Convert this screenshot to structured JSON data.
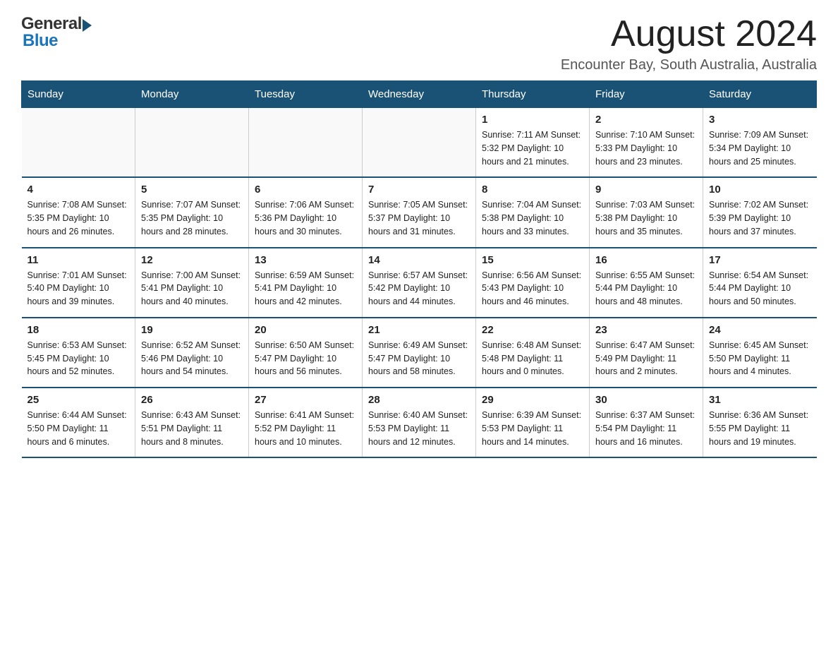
{
  "header": {
    "logo_general": "General",
    "logo_blue": "Blue",
    "month_title": "August 2024",
    "location": "Encounter Bay, South Australia, Australia"
  },
  "days_of_week": [
    "Sunday",
    "Monday",
    "Tuesday",
    "Wednesday",
    "Thursday",
    "Friday",
    "Saturday"
  ],
  "weeks": [
    [
      {
        "day": "",
        "info": ""
      },
      {
        "day": "",
        "info": ""
      },
      {
        "day": "",
        "info": ""
      },
      {
        "day": "",
        "info": ""
      },
      {
        "day": "1",
        "info": "Sunrise: 7:11 AM\nSunset: 5:32 PM\nDaylight: 10 hours\nand 21 minutes."
      },
      {
        "day": "2",
        "info": "Sunrise: 7:10 AM\nSunset: 5:33 PM\nDaylight: 10 hours\nand 23 minutes."
      },
      {
        "day": "3",
        "info": "Sunrise: 7:09 AM\nSunset: 5:34 PM\nDaylight: 10 hours\nand 25 minutes."
      }
    ],
    [
      {
        "day": "4",
        "info": "Sunrise: 7:08 AM\nSunset: 5:35 PM\nDaylight: 10 hours\nand 26 minutes."
      },
      {
        "day": "5",
        "info": "Sunrise: 7:07 AM\nSunset: 5:35 PM\nDaylight: 10 hours\nand 28 minutes."
      },
      {
        "day": "6",
        "info": "Sunrise: 7:06 AM\nSunset: 5:36 PM\nDaylight: 10 hours\nand 30 minutes."
      },
      {
        "day": "7",
        "info": "Sunrise: 7:05 AM\nSunset: 5:37 PM\nDaylight: 10 hours\nand 31 minutes."
      },
      {
        "day": "8",
        "info": "Sunrise: 7:04 AM\nSunset: 5:38 PM\nDaylight: 10 hours\nand 33 minutes."
      },
      {
        "day": "9",
        "info": "Sunrise: 7:03 AM\nSunset: 5:38 PM\nDaylight: 10 hours\nand 35 minutes."
      },
      {
        "day": "10",
        "info": "Sunrise: 7:02 AM\nSunset: 5:39 PM\nDaylight: 10 hours\nand 37 minutes."
      }
    ],
    [
      {
        "day": "11",
        "info": "Sunrise: 7:01 AM\nSunset: 5:40 PM\nDaylight: 10 hours\nand 39 minutes."
      },
      {
        "day": "12",
        "info": "Sunrise: 7:00 AM\nSunset: 5:41 PM\nDaylight: 10 hours\nand 40 minutes."
      },
      {
        "day": "13",
        "info": "Sunrise: 6:59 AM\nSunset: 5:41 PM\nDaylight: 10 hours\nand 42 minutes."
      },
      {
        "day": "14",
        "info": "Sunrise: 6:57 AM\nSunset: 5:42 PM\nDaylight: 10 hours\nand 44 minutes."
      },
      {
        "day": "15",
        "info": "Sunrise: 6:56 AM\nSunset: 5:43 PM\nDaylight: 10 hours\nand 46 minutes."
      },
      {
        "day": "16",
        "info": "Sunrise: 6:55 AM\nSunset: 5:44 PM\nDaylight: 10 hours\nand 48 minutes."
      },
      {
        "day": "17",
        "info": "Sunrise: 6:54 AM\nSunset: 5:44 PM\nDaylight: 10 hours\nand 50 minutes."
      }
    ],
    [
      {
        "day": "18",
        "info": "Sunrise: 6:53 AM\nSunset: 5:45 PM\nDaylight: 10 hours\nand 52 minutes."
      },
      {
        "day": "19",
        "info": "Sunrise: 6:52 AM\nSunset: 5:46 PM\nDaylight: 10 hours\nand 54 minutes."
      },
      {
        "day": "20",
        "info": "Sunrise: 6:50 AM\nSunset: 5:47 PM\nDaylight: 10 hours\nand 56 minutes."
      },
      {
        "day": "21",
        "info": "Sunrise: 6:49 AM\nSunset: 5:47 PM\nDaylight: 10 hours\nand 58 minutes."
      },
      {
        "day": "22",
        "info": "Sunrise: 6:48 AM\nSunset: 5:48 PM\nDaylight: 11 hours\nand 0 minutes."
      },
      {
        "day": "23",
        "info": "Sunrise: 6:47 AM\nSunset: 5:49 PM\nDaylight: 11 hours\nand 2 minutes."
      },
      {
        "day": "24",
        "info": "Sunrise: 6:45 AM\nSunset: 5:50 PM\nDaylight: 11 hours\nand 4 minutes."
      }
    ],
    [
      {
        "day": "25",
        "info": "Sunrise: 6:44 AM\nSunset: 5:50 PM\nDaylight: 11 hours\nand 6 minutes."
      },
      {
        "day": "26",
        "info": "Sunrise: 6:43 AM\nSunset: 5:51 PM\nDaylight: 11 hours\nand 8 minutes."
      },
      {
        "day": "27",
        "info": "Sunrise: 6:41 AM\nSunset: 5:52 PM\nDaylight: 11 hours\nand 10 minutes."
      },
      {
        "day": "28",
        "info": "Sunrise: 6:40 AM\nSunset: 5:53 PM\nDaylight: 11 hours\nand 12 minutes."
      },
      {
        "day": "29",
        "info": "Sunrise: 6:39 AM\nSunset: 5:53 PM\nDaylight: 11 hours\nand 14 minutes."
      },
      {
        "day": "30",
        "info": "Sunrise: 6:37 AM\nSunset: 5:54 PM\nDaylight: 11 hours\nand 16 minutes."
      },
      {
        "day": "31",
        "info": "Sunrise: 6:36 AM\nSunset: 5:55 PM\nDaylight: 11 hours\nand 19 minutes."
      }
    ]
  ]
}
